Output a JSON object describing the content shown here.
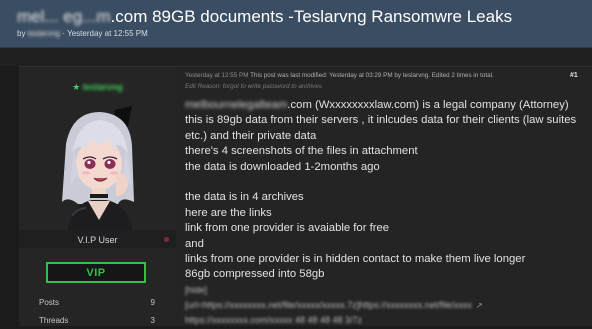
{
  "thread": {
    "title_blurred": "mel... eg...m",
    "title_rest": ".com 89GB documents -Teslarvng Ransomwre Leaks",
    "author_prefix": "by ",
    "author_blurred": "teslarvng",
    "timestamp": " · Yesterday at 12:55 PM"
  },
  "user": {
    "star": "★",
    "name": "teslarvng",
    "rank": "V.I.P User",
    "badge": "VIP",
    "stats": [
      {
        "label": "Posts",
        "value": "9"
      },
      {
        "label": "Threads",
        "value": "3"
      }
    ]
  },
  "post": {
    "time": "Yesterday at 12:55 PM",
    "modified": "  This post was last modified: Yesterday at 03:29 PM by teslarvng. Edited 2 times in total.",
    "number": "#1",
    "edit_reason": "Edit Reason: forgot to write password to archives",
    "line1_blur": "melbournelegalteam",
    "line1_rest": ".com (Wxxxxxxxxlaw.com) is a legal company (Attorney)",
    "line2": "this is 89gb data from their servers , it inlcudes data for their clients (law suites",
    "line3": "etc.) and their private data",
    "line4": "there's 4 screenshots of the files in attachment",
    "line5": "the data is downloaded 1-2months ago",
    "line6": "the data is in 4 archives",
    "line7": "here are the links",
    "line8": "link from one provider is avaiable for free",
    "line9": "and",
    "line10": "links from one provider is in hidden contact to make them live longer",
    "line11": "86gb compressed into 58gb",
    "line12": "[hide]",
    "line13": "[url=https://xxxxxxxx.net/file/xxxxx/xxxxx.7z]https://xxxxxxxx.net/file/xxxx",
    "line14": "https://xxxxxxxx.com/xxxxx 48 48 48 48 3/7z"
  }
}
